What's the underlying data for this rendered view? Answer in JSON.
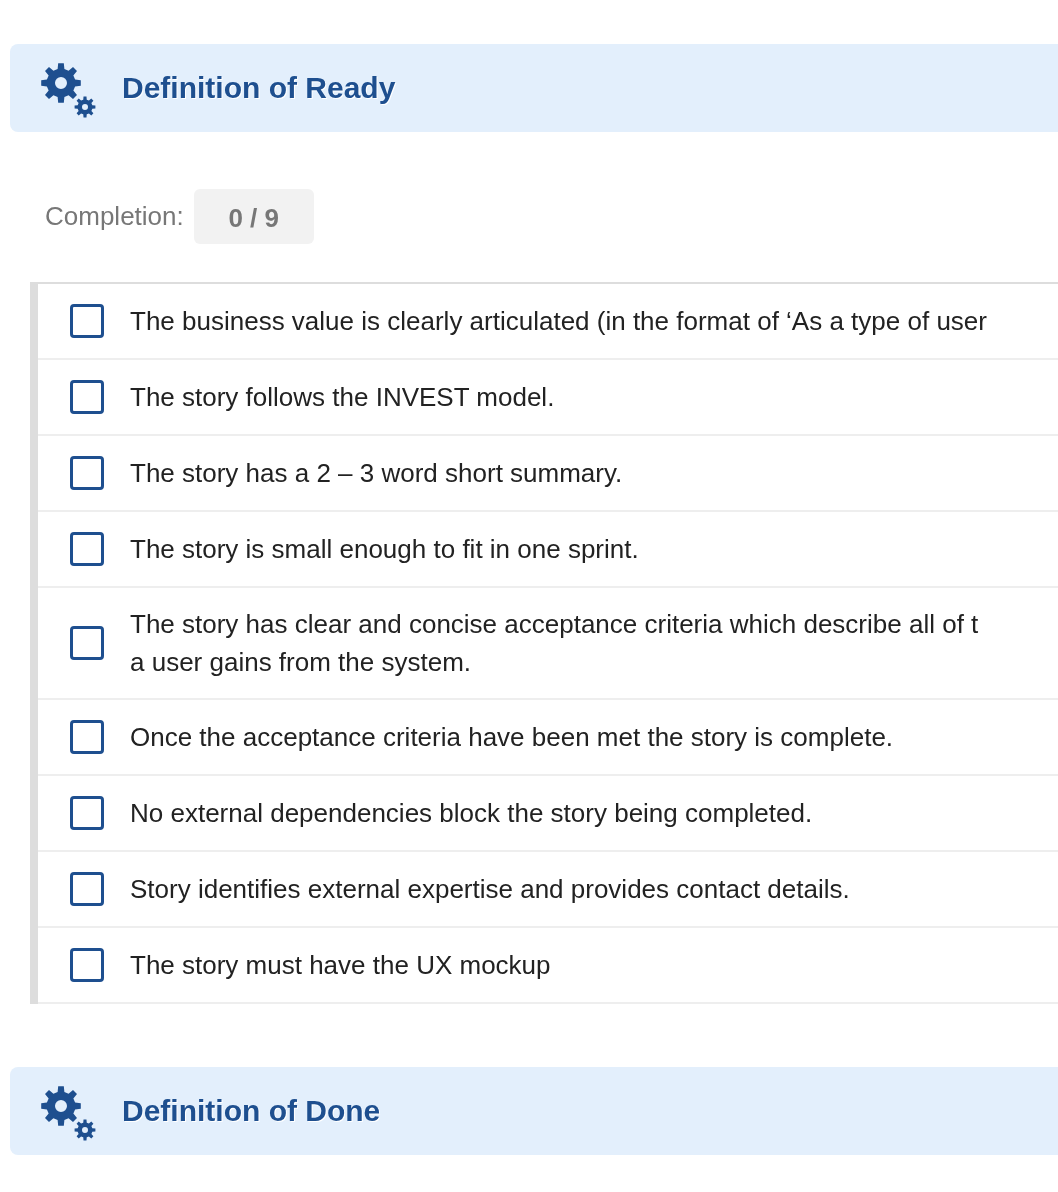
{
  "sections": [
    {
      "title": "Definition of Ready",
      "completion": {
        "label": "Completion:",
        "value": "0 / 9"
      },
      "items": [
        {
          "lines": [
            "The business value is clearly articulated (in the format of ‘As a type of user"
          ],
          "checked": false
        },
        {
          "lines": [
            "The story follows the INVEST model."
          ],
          "checked": false
        },
        {
          "lines": [
            "The story has a 2 – 3 word short summary."
          ],
          "checked": false
        },
        {
          "lines": [
            "The story is small enough to fit in one sprint."
          ],
          "checked": false
        },
        {
          "lines": [
            "The story has clear and concise acceptance criteria which describe all of t",
            "a user gains from the system."
          ],
          "checked": false
        },
        {
          "lines": [
            "Once the acceptance criteria have been met the story is complete."
          ],
          "checked": false
        },
        {
          "lines": [
            "No external dependencies block the story being completed."
          ],
          "checked": false
        },
        {
          "lines": [
            "Story identifies external expertise and provides contact details."
          ],
          "checked": false
        },
        {
          "lines": [
            "The story must have the UX mockup"
          ],
          "checked": false
        }
      ]
    },
    {
      "title": "Definition of Done"
    }
  ]
}
